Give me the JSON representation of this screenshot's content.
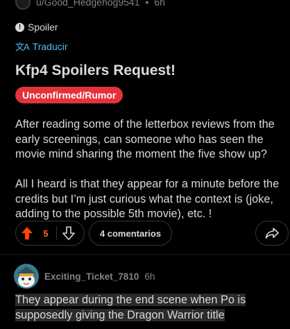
{
  "post": {
    "author": "u/Good_Hedgehog9541",
    "time_sep": "•",
    "time": "6h",
    "spoiler_label": "Spoiler",
    "translate_label": "Traducir",
    "title": "Kfp4 Spoilers Request!",
    "flair": "Unconfirmed/Rumor",
    "body": [
      "After reading some of the letterbox reviews from the early screenings, can someone who has seen the movie mind sharing the moment the five show up?",
      "All I heard is that they appear for a minute before the credits but I’m just curious what the context is (joke, adding to the possible 5th movie), etc. !"
    ]
  },
  "actions": {
    "vote_count": "5",
    "comments_label": "4 comentarios"
  },
  "comment": {
    "author": "Exciting_Ticket_7810",
    "time": "6h",
    "text": "They appear during the end scene when Po is supposedly giving the Dragon Warrior title"
  },
  "colors": {
    "accent_upvote": "#ff4500",
    "flair_bg": "#e2333d",
    "link_blue": "#4fbcff",
    "background": "#000000"
  },
  "icons": [
    "spoiler-icon",
    "translate-icon",
    "upvote-arrow-icon",
    "downvote-arrow-icon",
    "share-icon"
  ]
}
